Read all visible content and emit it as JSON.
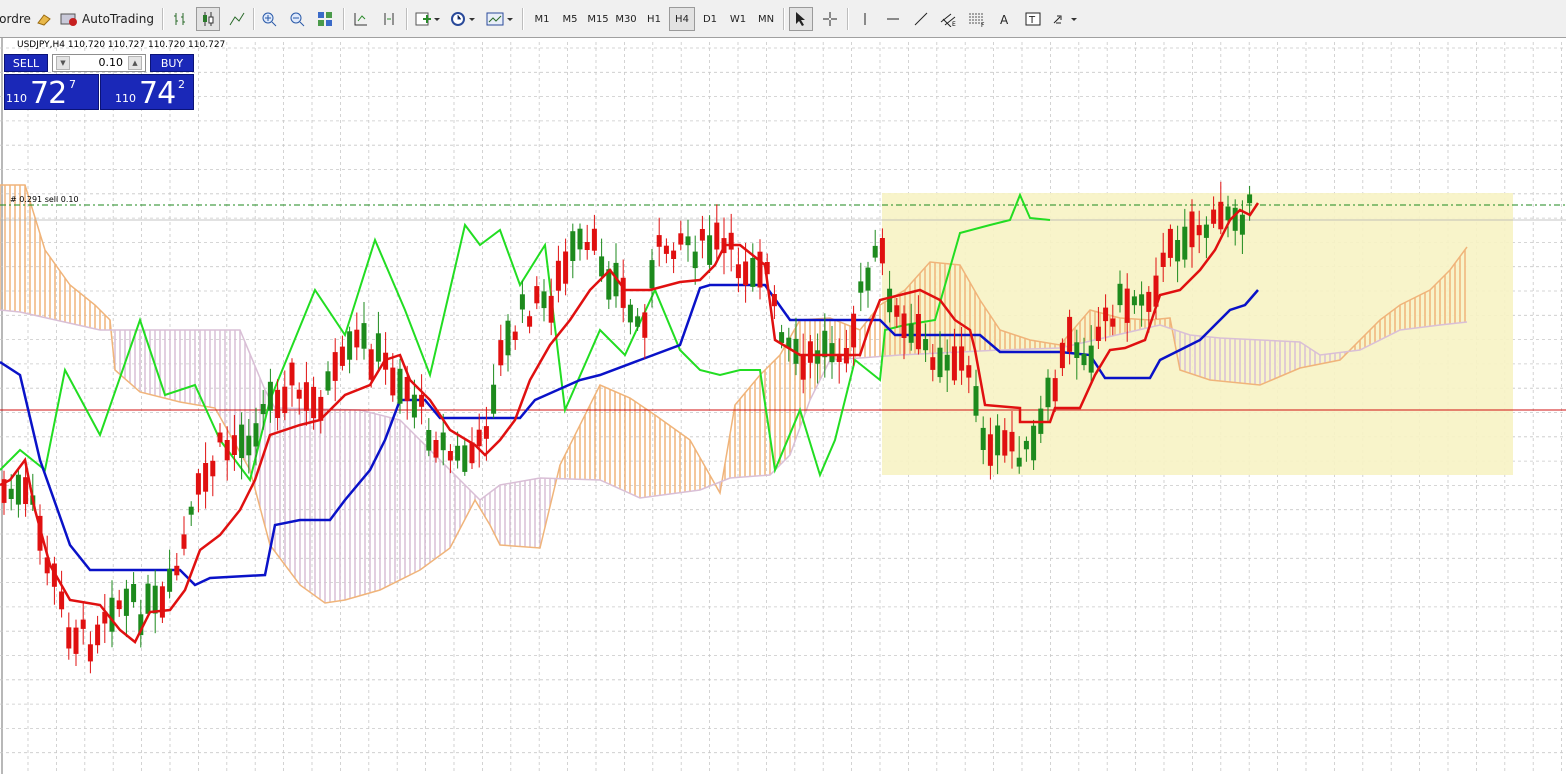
{
  "toolbar": {
    "new_order_label": "ordre",
    "autotrading_label": "AutoTrading",
    "timeframes": [
      "M1",
      "M5",
      "M15",
      "M30",
      "H1",
      "H4",
      "D1",
      "W1",
      "MN"
    ],
    "active_timeframe": "H4"
  },
  "chart": {
    "title": "USDJPY,H4  110.720 110.727 110.720 110.727",
    "order_label": "#  0.291 sell 0.10",
    "colors": {
      "grid": "#c8c8c8",
      "tenkan": "#e01010",
      "kijun": "#0a12c8",
      "chikou": "#22dd22",
      "cloud_up": "#f0b47a",
      "cloud_down": "#d9bfd6",
      "bull_candle": "#1d8a1d",
      "bear_candle": "#e01010",
      "price_line": "#d01010",
      "order_line": "#1d8a1d",
      "highlight": "#f7f3c4"
    }
  },
  "oneclick": {
    "sell_label": "SELL",
    "buy_label": "BUY",
    "lot": "0.10",
    "sell_price": {
      "small": "110",
      "big": "72",
      "sup": "7"
    },
    "buy_price": {
      "small": "110",
      "big": "74",
      "sup": "2"
    }
  }
}
